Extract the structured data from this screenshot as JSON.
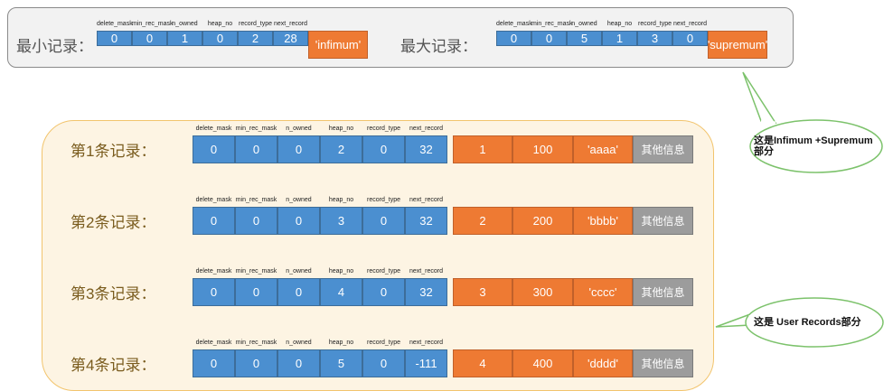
{
  "headers": [
    "delete_mask",
    "min_rec_mask",
    "n_owned",
    "heap_no",
    "record_type",
    "next_record"
  ],
  "min_record": {
    "label": "最小记录：",
    "values": [
      "0",
      "0",
      "1",
      "0",
      "2",
      "28"
    ],
    "name": "'infimum'"
  },
  "max_record": {
    "label": "最大记录：",
    "values": [
      "0",
      "0",
      "5",
      "1",
      "3",
      "0"
    ],
    "name": "'supremum'"
  },
  "user_records": [
    {
      "label": "第1条记录：",
      "values": [
        "0",
        "0",
        "0",
        "2",
        "0",
        "32"
      ],
      "fields": [
        "1",
        "100",
        "'aaaa'"
      ],
      "other": "其他信息"
    },
    {
      "label": "第2条记录：",
      "values": [
        "0",
        "0",
        "0",
        "3",
        "0",
        "32"
      ],
      "fields": [
        "2",
        "200",
        "'bbbb'"
      ],
      "other": "其他信息"
    },
    {
      "label": "第3条记录：",
      "values": [
        "0",
        "0",
        "0",
        "4",
        "0",
        "32"
      ],
      "fields": [
        "3",
        "300",
        "'cccc'"
      ],
      "other": "其他信息"
    },
    {
      "label": "第4条记录：",
      "values": [
        "0",
        "0",
        "0",
        "5",
        "0",
        "-111"
      ],
      "fields": [
        "4",
        "400",
        "'dddd'"
      ],
      "other": "其他信息"
    }
  ],
  "callouts": {
    "infimum_supremum": "这是Infimum +Supremum部分",
    "user_records": "这是 User Records部分"
  },
  "colors": {
    "header_blue": "#4b8fd0",
    "field_orange": "#ee7a33",
    "other_gray": "#9c9c9c",
    "user_box_border": "#f2c46d",
    "callout_border": "#7cc26b"
  }
}
